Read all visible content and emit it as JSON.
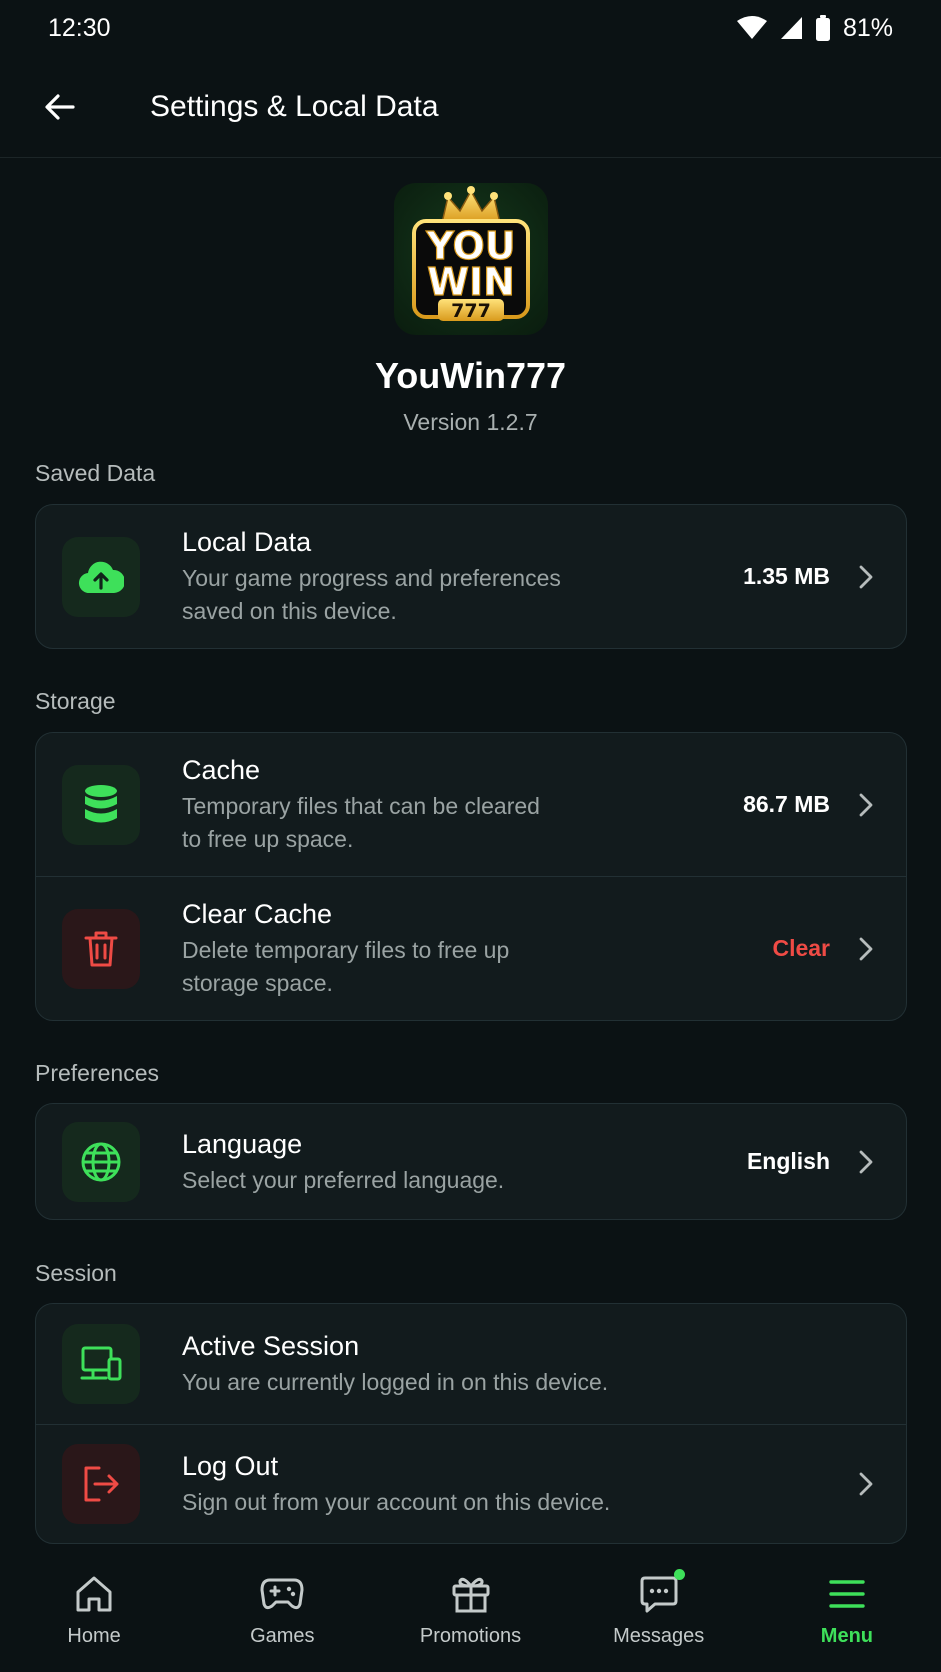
{
  "status_bar": {
    "time": "12:30",
    "battery": "81%"
  },
  "app_bar": {
    "title": "Settings & Local Data"
  },
  "app_info": {
    "logo_top": "YOU",
    "logo_bottom": "WIN",
    "logo_number": "777",
    "name": "YouWin777",
    "version": "Version 1.2.7"
  },
  "sections": {
    "saved_data": {
      "title": "Saved Data",
      "local_data": {
        "title": "Local Data",
        "subtitle_1": "Your game progress and preferences",
        "subtitle_2": "saved on this device.",
        "value": "1.35 MB",
        "icon": "cloud-upload-icon"
      }
    },
    "storage": {
      "title": "Storage",
      "cache": {
        "title": "Cache",
        "subtitle_1": "Temporary files that can be cleared",
        "subtitle_2": "to free up space.",
        "value": "86.7 MB",
        "icon": "database-icon"
      },
      "clear_cache": {
        "title": "Clear Cache",
        "subtitle_1": "Delete temporary files to free up",
        "subtitle_2": "storage space.",
        "value": "Clear",
        "icon": "trash-icon"
      }
    },
    "preferences": {
      "title": "Preferences",
      "language": {
        "title": "Language",
        "subtitle": "Select your preferred language.",
        "value": "English",
        "icon": "globe-icon"
      }
    },
    "session": {
      "title": "Session",
      "active_session": {
        "title": "Active Session",
        "subtitle": "You are currently logged in on this device.",
        "icon": "devices-icon"
      },
      "log_out": {
        "title": "Log Out",
        "subtitle": "Sign out from your account on this device.",
        "icon": "logout-icon"
      }
    }
  },
  "bottom_nav": {
    "items": [
      {
        "label": "Home",
        "icon": "home-icon"
      },
      {
        "label": "Games",
        "icon": "gamepad-icon"
      },
      {
        "label": "Promotions",
        "icon": "gift-icon"
      },
      {
        "label": "Messages",
        "icon": "chat-icon"
      },
      {
        "label": "Menu",
        "icon": "menu-icon"
      }
    ],
    "active": "Menu"
  },
  "colors": {
    "accent": "#3ee05a",
    "danger": "#ef4b45",
    "background": "#0b1214",
    "card": "#121b1d"
  }
}
